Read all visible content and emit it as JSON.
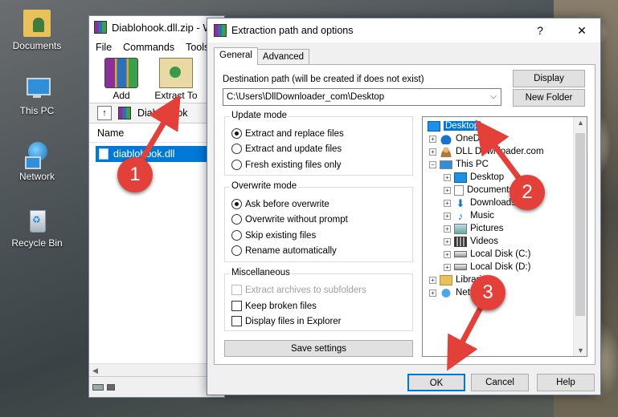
{
  "desktop": {
    "icons": [
      {
        "label": "Documents",
        "icon": "documents-user-icon"
      },
      {
        "label": "This PC",
        "icon": "this-pc-icon"
      },
      {
        "label": "Network",
        "icon": "network-icon"
      },
      {
        "label": "Recycle Bin",
        "icon": "recycle-bin-icon"
      }
    ]
  },
  "winrar": {
    "title": "Diablohook.dll.zip - W",
    "menu": [
      "File",
      "Commands",
      "Tools"
    ],
    "toolbar": {
      "add_label": "Add",
      "extract_label": "Extract To",
      "third_label": "T"
    },
    "path_label": "Diablohook",
    "column_name": "Name",
    "file_name": "diablohook.dll"
  },
  "dialog": {
    "title": "Extraction path and options",
    "help_symbol": "?",
    "close_symbol": "✕",
    "tabs": [
      "General",
      "Advanced"
    ],
    "dest_label": "Destination path (will be created if does not exist)",
    "dest_value": "C:\\Users\\DllDownloader_com\\Desktop",
    "display_button": "Display",
    "new_folder_button": "New Folder",
    "update_mode": {
      "title": "Update mode",
      "options": [
        "Extract and replace files",
        "Extract and update files",
        "Fresh existing files only"
      ],
      "selected": 0
    },
    "overwrite_mode": {
      "title": "Overwrite mode",
      "options": [
        "Ask before overwrite",
        "Overwrite without prompt",
        "Skip existing files",
        "Rename automatically"
      ],
      "selected": 0
    },
    "misc": {
      "title": "Miscellaneous",
      "options": [
        "Extract archives to subfolders",
        "Keep broken files",
        "Display files in Explorer"
      ]
    },
    "save_settings_button": "Save settings",
    "tree": [
      "Desktop",
      "OneD",
      "DLL Downloader.com",
      "This PC",
      "Desktop",
      "Documents",
      "Downloads",
      "Music",
      "Pictures",
      "Videos",
      "Local Disk (C:)",
      "Local Disk (D:)",
      "Libraries",
      "Netw"
    ],
    "ok_button": "OK",
    "cancel_button": "Cancel",
    "help_button": "Help"
  },
  "annotations": {
    "badges": [
      "1",
      "2",
      "3"
    ],
    "color": "#e3403a"
  }
}
